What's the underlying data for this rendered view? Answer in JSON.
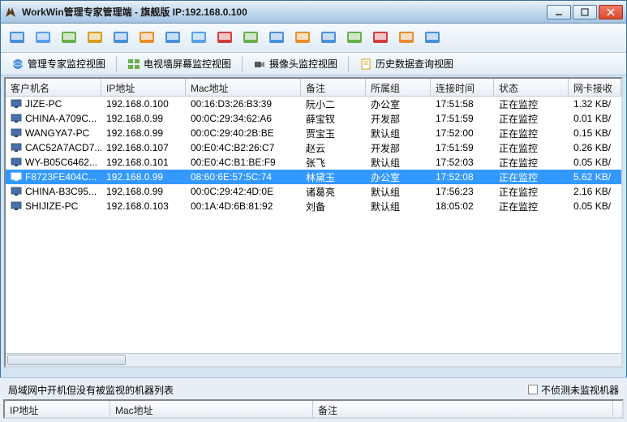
{
  "window": {
    "title": "WorkWin管理专家管理端 - 旗舰版 IP:192.168.0.100"
  },
  "views": {
    "v1": "管理专家监控视图",
    "v2": "电视墙屏幕监控视图",
    "v3": "摄像头监控视图",
    "v4": "历史数据查询视图"
  },
  "columns": {
    "c0": "客户机名",
    "c1": "IP地址",
    "c2": "Mac地址",
    "c3": "备注",
    "c4": "所属组",
    "c5": "连接时间",
    "c6": "状态",
    "c7": "网卡接收"
  },
  "rows": [
    {
      "name": "JIZE-PC",
      "ip": "192.168.0.100",
      "mac": "00:16:D3:26:B3:39",
      "note": "阮小二",
      "group": "办公室",
      "time": "17:51:58",
      "status": "正在监控",
      "net": "1.32 KB/",
      "sel": false
    },
    {
      "name": "CHINA-A709C...",
      "ip": "192.168.0.99",
      "mac": "00:0C:29:34:62:A6",
      "note": "薛宝钗",
      "group": "开发部",
      "time": "17:51:59",
      "status": "正在监控",
      "net": "0.01 KB/",
      "sel": false
    },
    {
      "name": "WANGYA7-PC",
      "ip": "192.168.0.99",
      "mac": "00:0C:29:40:2B:BE",
      "note": "贾宝玉",
      "group": "默认组",
      "time": "17:52:00",
      "status": "正在监控",
      "net": "0.15 KB/",
      "sel": false
    },
    {
      "name": "CAC52A7ACD7...",
      "ip": "192.168.0.107",
      "mac": "00:E0:4C:B2:26:C7",
      "note": "赵云",
      "group": "开发部",
      "time": "17:51:59",
      "status": "正在监控",
      "net": "0.26 KB/",
      "sel": false
    },
    {
      "name": "WY-B05C6462...",
      "ip": "192.168.0.101",
      "mac": "00:E0:4C:B1:BE:F9",
      "note": "张飞",
      "group": "默认组",
      "time": "17:52:03",
      "status": "正在监控",
      "net": "0.05 KB/",
      "sel": false
    },
    {
      "name": "F8723FE404C...",
      "ip": "192.168.0.99",
      "mac": "08:60:6E:57:5C:74",
      "note": "林黛玉",
      "group": "办公室",
      "time": "17:52:08",
      "status": "正在监控",
      "net": "5.62 KB/",
      "sel": true
    },
    {
      "name": "CHINA-B3C95...",
      "ip": "192.168.0.99",
      "mac": "00:0C:29:42:4D:0E",
      "note": "诸葛亮",
      "group": "默认组",
      "time": "17:56:23",
      "status": "正在监控",
      "net": "2.16 KB/",
      "sel": false
    },
    {
      "name": "SHIJIZE-PC",
      "ip": "192.168.0.103",
      "mac": "00:1A:4D:6B:81:92",
      "note": "刘备",
      "group": "默认组",
      "time": "18:05:02",
      "status": "正在监控",
      "net": "0.05 KB/",
      "sel": false
    }
  ],
  "bottom": {
    "title": "局域网中开机但没有被监视的机器列表",
    "checkbox": "不侦测未监视机器",
    "cols": {
      "c0": "IP地址",
      "c1": "Mac地址",
      "c2": "备注"
    }
  },
  "toolbar_icons": [
    "home-icon",
    "monitor-icon",
    "screens-icon",
    "share-icon",
    "refresh-icon",
    "folder-icon",
    "window-icon",
    "send-icon",
    "lock-icon",
    "chat-icon",
    "globe-icon",
    "pie-icon",
    "clock-icon",
    "calendar-icon",
    "capture-icon",
    "user-icon",
    "help-icon"
  ]
}
